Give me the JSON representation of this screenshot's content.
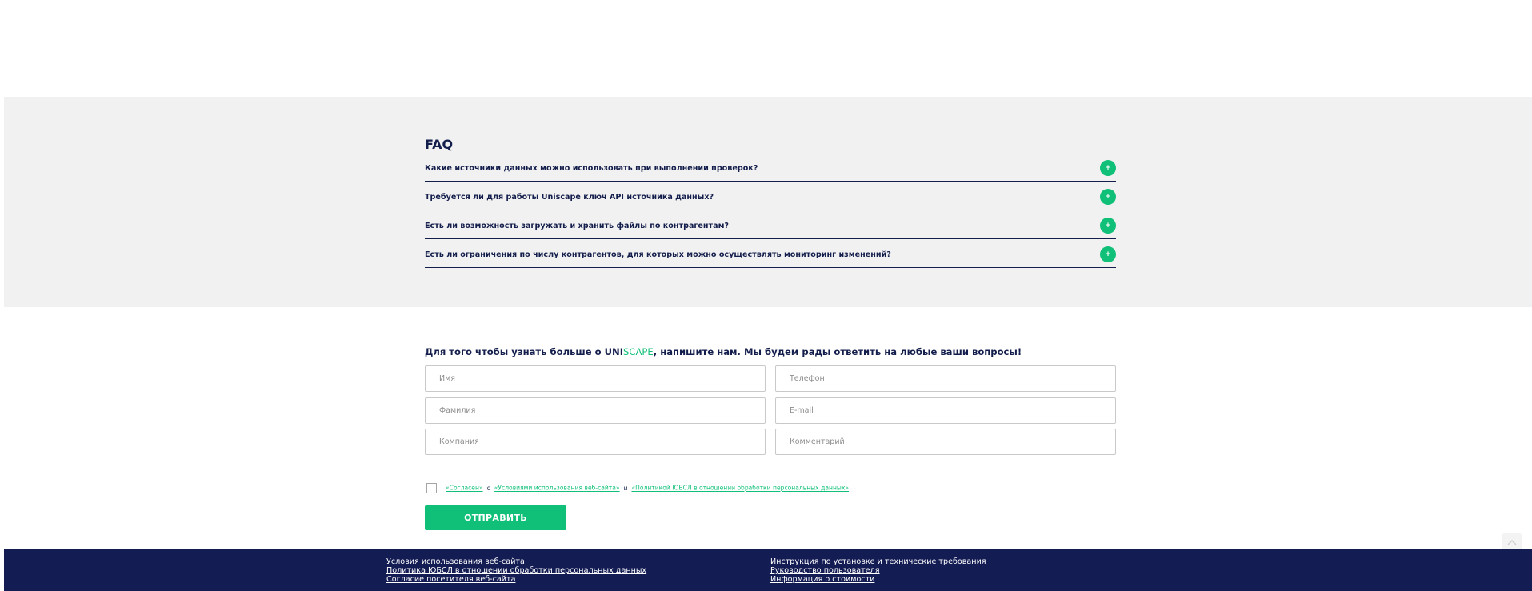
{
  "faq": {
    "title": "FAQ",
    "items": [
      {
        "question": "Какие источники данных можно использовать при выполнении проверок?"
      },
      {
        "question": "Требуется ли для работы Uniscape ключ API источника данных?"
      },
      {
        "question": "Есть ли возможность загружать и хранить файлы по контрагентам?"
      },
      {
        "question": "Есть ли ограничения по числу контрагентов, для которых можно осуществлять мониторинг изменений?"
      }
    ],
    "toggle_symbol": "+",
    "toggle_color": "#10c078"
  },
  "contact": {
    "heading_before": "Для того чтобы узнать больше о UNI",
    "heading_brand": "SCAPE",
    "heading_after": ", напишите нам. Мы будем рады ответить на любые ваши вопросы!",
    "fields": {
      "name": {
        "placeholder": "Имя",
        "value": ""
      },
      "phone": {
        "placeholder": "Телефон",
        "value": ""
      },
      "surname": {
        "placeholder": "Фамилия",
        "value": ""
      },
      "email": {
        "placeholder": "E-mail",
        "value": ""
      },
      "company": {
        "placeholder": "Компания",
        "value": ""
      },
      "comment": {
        "placeholder": "Комментарий",
        "value": ""
      }
    },
    "consent": {
      "agree_link": "«Согласен»",
      "with": "с",
      "terms_link": "«Условиями использования веб-сайта»",
      "and": "и",
      "policy_link": "«Политикой ЮБСЛ в отношении обработки персональных данных»",
      "checked": false
    },
    "submit_label": "ОТПРАВИТЬ"
  },
  "footer": {
    "left_links": [
      "Условия использования веб-сайта",
      "Политика ЮБСЛ в отношении обработки персональных данных",
      "Согласие посетителя веб-сайта"
    ],
    "right_links": [
      "Инструкция по установке и технические требования",
      "Руководство пользователя",
      "Информация о стоимости"
    ]
  },
  "colors": {
    "accent": "#10c078",
    "navy": "#141e4c",
    "footer_bg": "#141c54",
    "faq_bg": "#f1f1f1"
  },
  "icons": {
    "scroll_top": "chevron-up-icon"
  }
}
